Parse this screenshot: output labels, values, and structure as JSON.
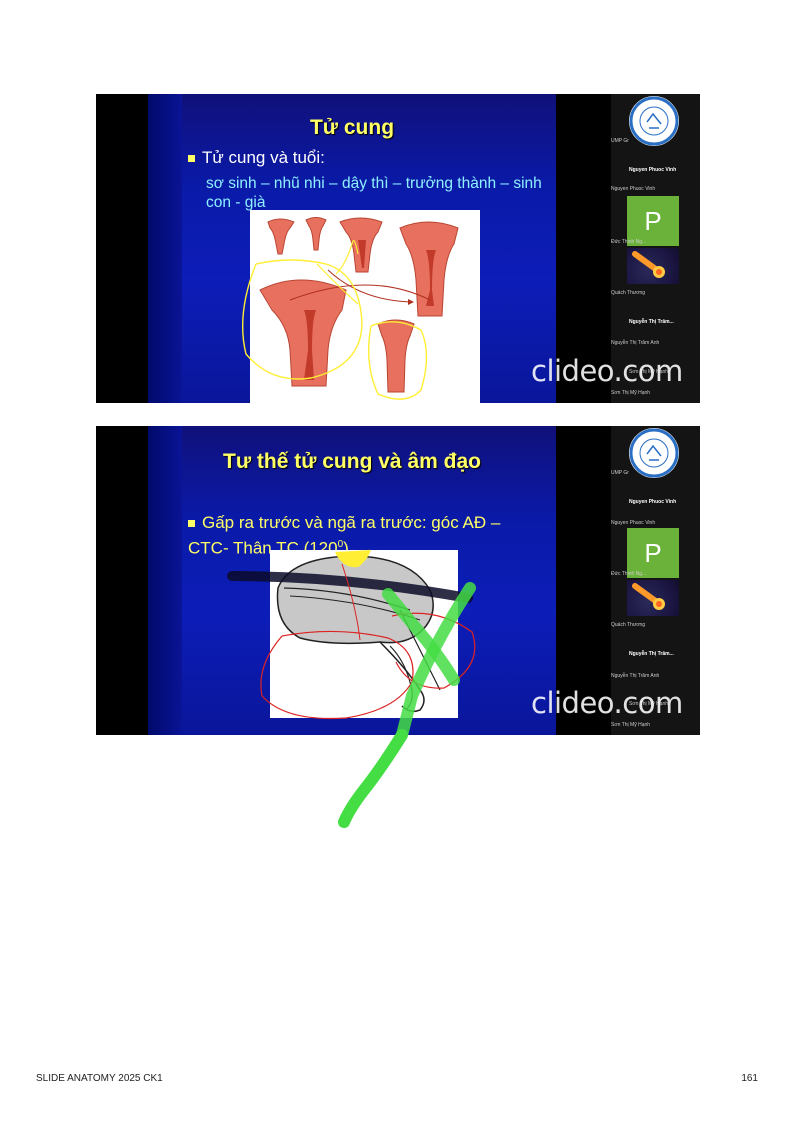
{
  "slide1": {
    "title": "Tử cung",
    "bullet": "Tử cung và tuổi:",
    "sub": "sơ sinh – nhũ nhi – dậy thì – trưởng thành – sinh con - già"
  },
  "slide2": {
    "title": "Tư thế tử cung và âm đạo",
    "bullet": "Gấp ra trước và ngã ra trước: góc AĐ – CTC- Thân TC (120",
    "superscript": "0",
    "bullet_end": ")"
  },
  "watermark": "clideo.com",
  "participants": {
    "logo_label": "UMP Gr",
    "host": "Nguyen Phuoc Vinh",
    "host_sub": "Nguyen Phuoc Vinh",
    "p_avatar_letter": "P",
    "p_label": "Đức Thịnh Ng...",
    "meteor_label": "Quách Thương",
    "member": "Nguyễn Thị Trâm...",
    "member_sub": "Nguyễn Thị Trâm Anh",
    "overlay_label": "Sơn Thị Mỹ Hạnh",
    "bottom_label": "Sơn Thị Mỹ Hạnh"
  },
  "footer": {
    "left": "SLIDE ANATOMY 2025 CK1",
    "right": "161"
  },
  "colors": {
    "slide_bg": "#0c1db8",
    "title": "#ffff66",
    "sub_text": "#8ef0ff",
    "annotation_green": "#44dd44",
    "annotation_red": "#dd2222",
    "annotation_yellow": "#ffee33"
  }
}
